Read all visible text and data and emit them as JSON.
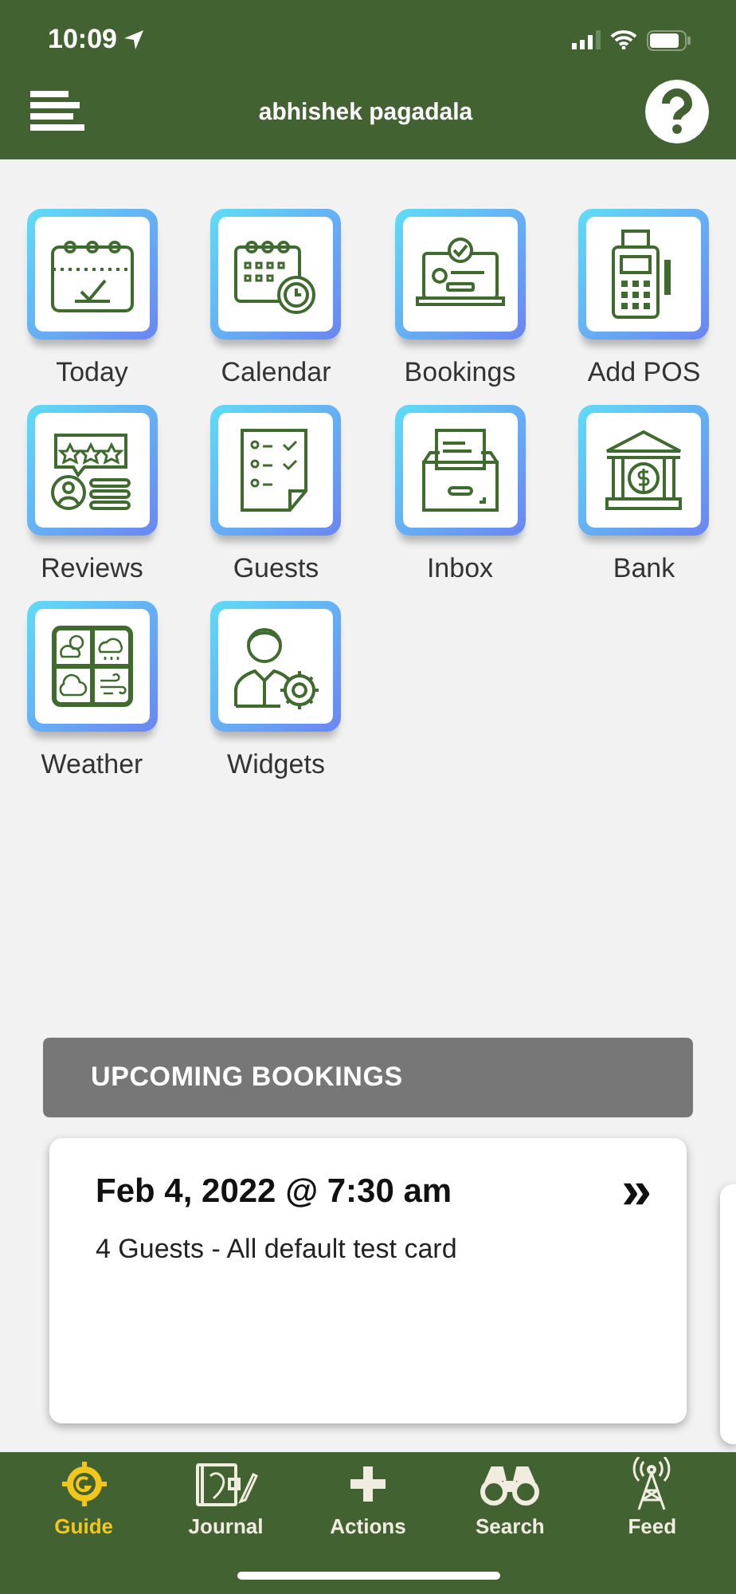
{
  "status_bar": {
    "time": "10:09"
  },
  "header": {
    "title": "abhishek pagadala"
  },
  "tiles": [
    {
      "label": "Today",
      "kind": "today"
    },
    {
      "label": "Calendar",
      "kind": "calendar"
    },
    {
      "label": "Bookings",
      "kind": "bookings"
    },
    {
      "label": "Add POS",
      "kind": "pos"
    },
    {
      "label": "Reviews",
      "kind": "reviews"
    },
    {
      "label": "Guests",
      "kind": "guests"
    },
    {
      "label": "Inbox",
      "kind": "inbox"
    },
    {
      "label": "Bank",
      "kind": "bank"
    },
    {
      "label": "Weather",
      "kind": "weather"
    },
    {
      "label": "Widgets",
      "kind": "widgets"
    }
  ],
  "upcoming": {
    "heading": "UPCOMING BOOKINGS",
    "bookings": [
      {
        "date": "Feb 4, 2022 @ 7:30 am",
        "details": "4 Guests - All default test card",
        "arrow": "»"
      }
    ]
  },
  "tab_bar": [
    {
      "label": "Guide",
      "kind": "guide",
      "selected": true
    },
    {
      "label": "Journal",
      "kind": "journal",
      "selected": false
    },
    {
      "label": "Actions",
      "kind": "actions",
      "selected": false
    },
    {
      "label": "Search",
      "kind": "search",
      "selected": false
    },
    {
      "label": "Feed",
      "kind": "feed",
      "selected": false
    }
  ]
}
